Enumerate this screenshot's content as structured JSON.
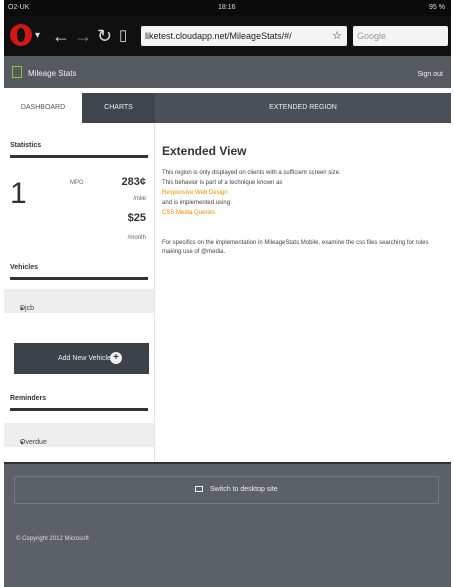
{
  "status_bar": {
    "carrier": "O2-UK",
    "time": "18:16",
    "battery": "95 %"
  },
  "browser": {
    "url": "liketest.cloudapp.net/MileageStats/#/",
    "search_placeholder": "Google"
  },
  "app": {
    "title": "Mileage Stats",
    "sign_out": "Sign out"
  },
  "tabs": {
    "dashboard": "DASHBOARD",
    "charts": "CHARTS",
    "extended": "EXTENDED REGION"
  },
  "left": {
    "statistics_heading": "Statistics",
    "mpg_value": "1",
    "mpg_label": "MPG",
    "cost_per_mile": "283¢",
    "per_mile": "/mile",
    "cost_per_month": "$25",
    "per_month": "/month",
    "vehicles_heading": "Vehicles",
    "vehicle_name": "Djcb",
    "add_vehicle": "Add New Vehicle",
    "reminders_heading": "Reminders",
    "overdue": "Overdue"
  },
  "extended": {
    "title": "Extended View",
    "line1": "This region is only displayed on clients with a sufficient screen size.",
    "line2": "This behavior is part of a technique known as",
    "link1": "Responsive Web Design",
    "line3": "and is implemented using",
    "link2": "CSS Media Queries",
    "line4": "For specifics on the implementation in MileageStats Mobile, examine the css files searching for rules making use of @media."
  },
  "footer": {
    "switch_desktop": "Switch to desktop site",
    "copyright": "© Copyright 2012 Microsoft"
  },
  "colors": {
    "accent_orange": "#f28c00",
    "header_gray": "#555a60",
    "tab_dark": "#3f454d",
    "opera_red": "#d21515"
  }
}
